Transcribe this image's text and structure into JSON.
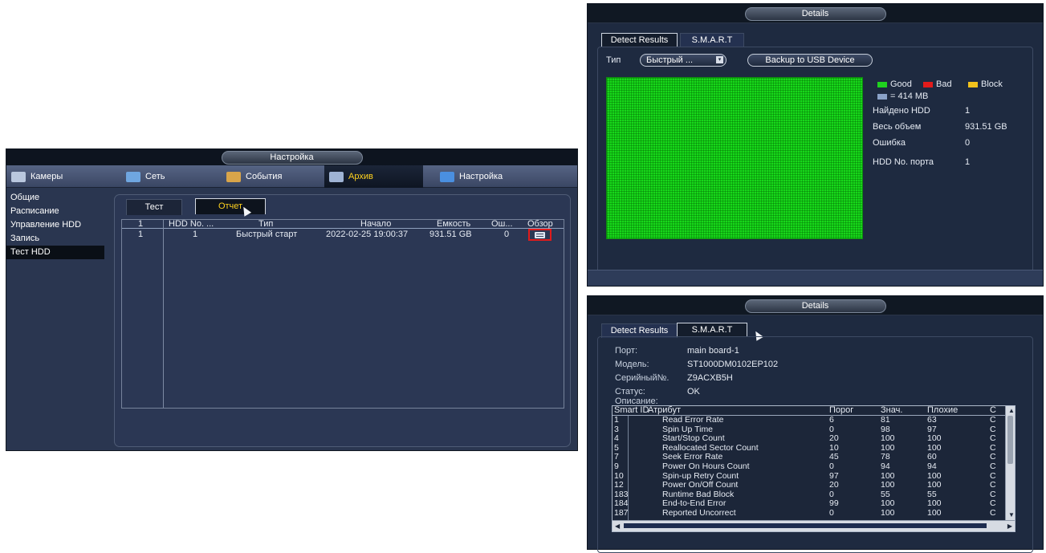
{
  "left_window": {
    "title": "Настройка",
    "nav": [
      {
        "label": "Камеры",
        "icon": "camera-icon"
      },
      {
        "label": "Сеть",
        "icon": "network-icon"
      },
      {
        "label": "События",
        "icon": "events-icon"
      },
      {
        "label": "Архив",
        "icon": "archive-icon"
      },
      {
        "label": "Настройка",
        "icon": "settings-icon"
      }
    ],
    "active_nav": "Архив",
    "sidebar": [
      "Общие",
      "Расписание",
      "Управление HDD",
      "Запись",
      "Тест HDD"
    ],
    "active_sidebar": "Тест HDD",
    "tabs": {
      "test": "Тест",
      "report": "Отчет"
    },
    "table": {
      "headers": [
        "1",
        "HDD No. ...",
        "Тип",
        "Начало",
        "Емкость",
        "Ош...",
        "Обзор"
      ],
      "row": [
        "1",
        "1",
        "Быстрый старт",
        "2022-02-25 19:00:37",
        "931.51 GB",
        "0"
      ]
    }
  },
  "details_top": {
    "title": "Details",
    "tabs": {
      "detect": "Detect Results",
      "smart": "S.M.A.R.T"
    },
    "type_label": "Тип",
    "type_value": "Быстрый ...",
    "backup_button": "Backup to USB Device",
    "legend": {
      "good": "Good",
      "bad": "Bad",
      "block": "Block",
      "unit": "= 414 MB"
    },
    "info": [
      {
        "label": "Найдено HDD",
        "value": "1"
      },
      {
        "label": "Весь объем",
        "value": "931.51 GB"
      },
      {
        "label": "Ошибка",
        "value": "0"
      },
      {
        "label": "HDD No. порта",
        "value": "1"
      }
    ],
    "colors": {
      "good": "#1fd21f",
      "bad": "#e21b1b",
      "block": "#f2c21c",
      "unit": "#8aa2c8"
    }
  },
  "details_bottom": {
    "title": "Details",
    "tabs": {
      "detect": "Detect Results",
      "smart": "S.M.A.R.T"
    },
    "fields": [
      {
        "label": "Порт:",
        "value": "main board-1"
      },
      {
        "label": "Модель:",
        "value": "ST1000DM0102EP102"
      },
      {
        "label": "Серийный№.",
        "value": "Z9ACXB5H"
      },
      {
        "label": "Статус:",
        "value": "OK"
      },
      {
        "label": "Описание:",
        "value": ""
      }
    ],
    "smart_headers": [
      "Smart ID",
      "Атрибут",
      "Порог",
      "Знач.",
      "Плохие",
      "С"
    ],
    "smart_rows": [
      [
        "1",
        "Read Error Rate",
        "6",
        "81",
        "63",
        "С"
      ],
      [
        "3",
        "Spin Up Time",
        "0",
        "98",
        "97",
        "С"
      ],
      [
        "4",
        "Start/Stop Count",
        "20",
        "100",
        "100",
        "С"
      ],
      [
        "5",
        "Reallocated Sector Count",
        "10",
        "100",
        "100",
        "С"
      ],
      [
        "7",
        "Seek Error Rate",
        "45",
        "78",
        "60",
        "С"
      ],
      [
        "9",
        "Power On Hours Count",
        "0",
        "94",
        "94",
        "С"
      ],
      [
        "10",
        "Spin-up Retry Count",
        "97",
        "100",
        "100",
        "С"
      ],
      [
        "12",
        "Power On/Off Count",
        "20",
        "100",
        "100",
        "С"
      ],
      [
        "183",
        "Runtime Bad Block",
        "0",
        "55",
        "55",
        "С"
      ],
      [
        "184",
        "End-to-End Error",
        "99",
        "100",
        "100",
        "С"
      ],
      [
        "187",
        "Reported Uncorrect",
        "0",
        "100",
        "100",
        "С"
      ]
    ]
  }
}
